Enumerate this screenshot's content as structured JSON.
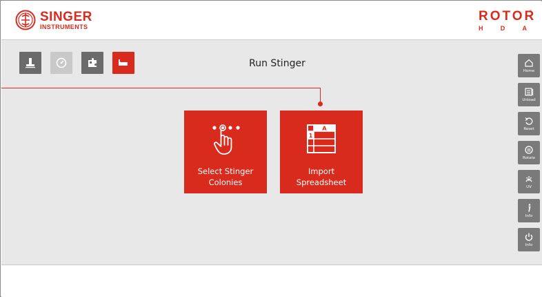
{
  "header": {
    "brand_left_line1": "SINGER",
    "brand_left_line2": "INSTRUMENTS",
    "brand_right_line1": "ROTOR",
    "brand_right_letters": [
      "H",
      "D",
      "A"
    ],
    "brand_right_tm": "™"
  },
  "toolbar": {
    "items": [
      {
        "icon": "stamp-icon",
        "state": "normal"
      },
      {
        "icon": "gauge-icon",
        "state": "disabled"
      },
      {
        "icon": "puzzle-icon",
        "state": "normal"
      },
      {
        "icon": "plate-icon",
        "state": "active"
      }
    ]
  },
  "main": {
    "title": "Run Stinger",
    "cards": [
      {
        "label_line1": "Select Stinger",
        "label_line2": "Colonies",
        "icon": "tap-hand-icon"
      },
      {
        "label_line1": "Import",
        "label_line2": "Spreadsheet",
        "icon": "spreadsheet-icon"
      }
    ],
    "spreadsheet_icon_text": {
      "col": "A",
      "row": "1"
    }
  },
  "sidepanel": {
    "items": [
      {
        "label": "Home",
        "icon": "home-icon"
      },
      {
        "label": "Unload",
        "icon": "unload-icon"
      },
      {
        "label": "Reset",
        "icon": "reset-icon"
      },
      {
        "label": "Rotate",
        "icon": "rotate-icon"
      },
      {
        "label": "UV",
        "icon": "uv-icon"
      },
      {
        "label": "Info",
        "icon": "info-icon"
      },
      {
        "label": "Info",
        "icon": "power-icon"
      }
    ]
  },
  "colors": {
    "accent": "#d92a1e",
    "panel": "#e8e8e8",
    "tool_dark": "#6b6b6b",
    "side_button": "#7a7a7a"
  }
}
